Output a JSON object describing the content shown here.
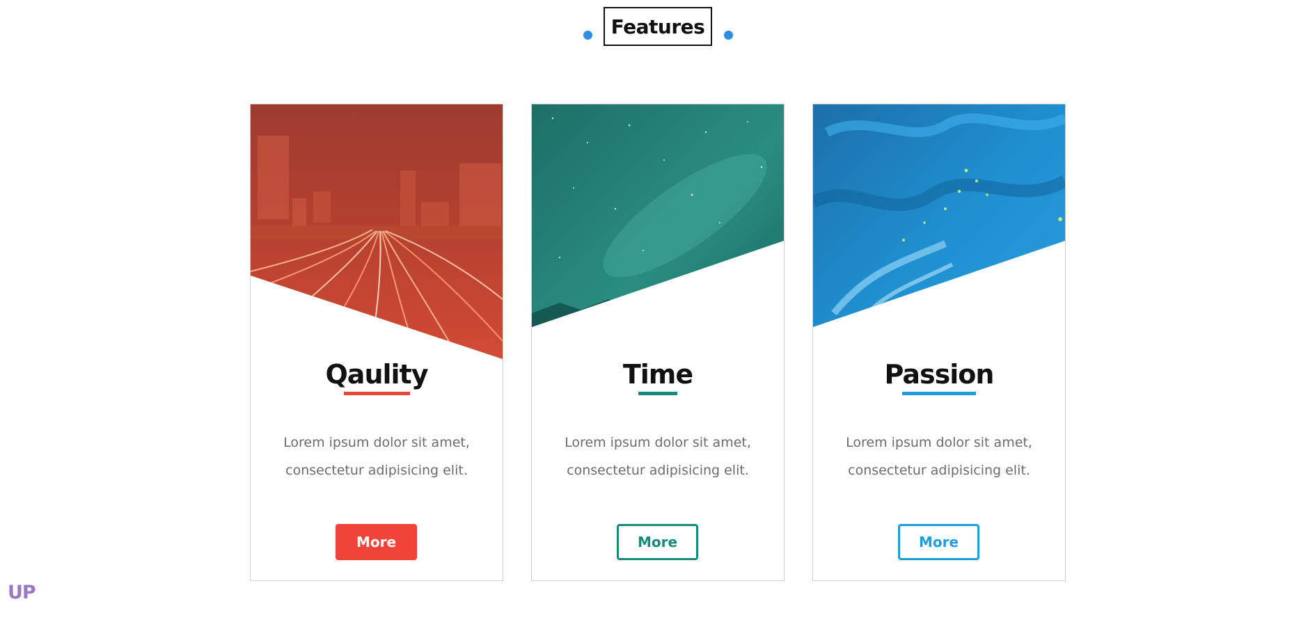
{
  "heading": {
    "title": "Features"
  },
  "colors": {
    "accent_dot": "#2f8de4",
    "red": "#f04438",
    "teal": "#168b7c",
    "blue": "#1e9fdb",
    "body_text": "#6b6b6b",
    "up": "#9b78c3"
  },
  "cards": [
    {
      "title": "Qaulity",
      "text_line1": "Lorem ipsum dolor sit amet,",
      "text_line2": "consectetur adipisicing elit.",
      "button": "More",
      "button_style": "filled",
      "color": "#f04438",
      "image": "city-light-trails-image"
    },
    {
      "title": "Time",
      "text_line1": "Lorem ipsum dolor sit amet,",
      "text_line2": "consectetur adipisicing elit.",
      "button": "More",
      "button_style": "outline",
      "color": "#168b7c",
      "image": "starry-sky-image"
    },
    {
      "title": "Passion",
      "text_line1": "Lorem ipsum dolor sit amet,",
      "text_line2": "consectetur adipisicing elit.",
      "button": "More",
      "button_style": "outline",
      "color": "#1e9fdb",
      "image": "blue-fluid-art-image"
    }
  ],
  "footer": {
    "up_label": "UP"
  }
}
